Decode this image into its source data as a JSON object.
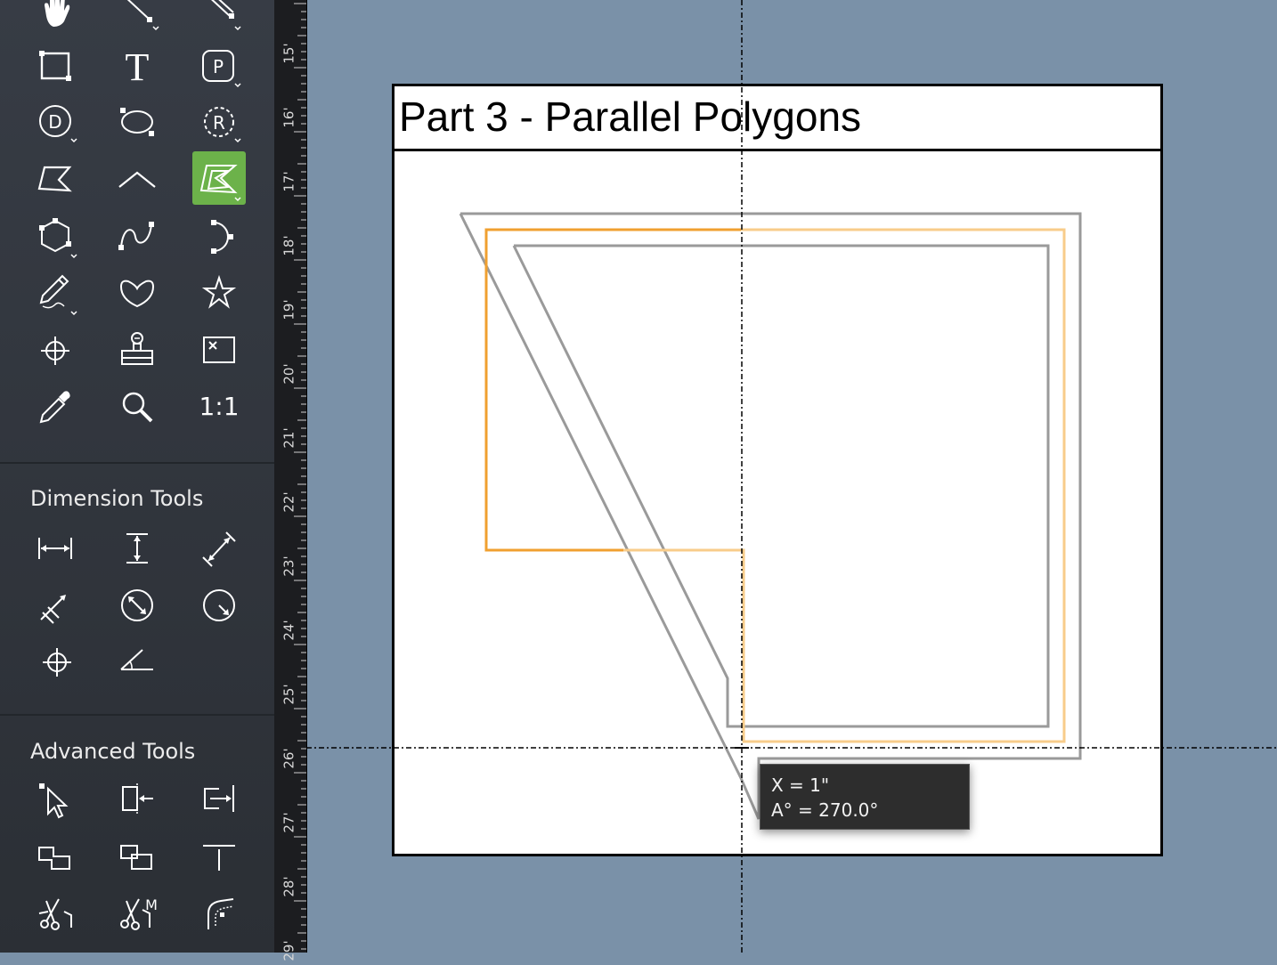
{
  "sidebar": {
    "dimension_tools_title": "Dimension Tools",
    "advanced_tools_title": "Advanced Tools",
    "actual_size_label": "1:1",
    "text_tool_glyph": "T",
    "point_tool_glyph": "P",
    "diameter_tool_glyph": "D",
    "radius_tool_glyph": "R",
    "active_tool_color": "#6cb24a",
    "move_tool_badge": "M"
  },
  "ruler": {
    "labels": [
      "15'",
      "16'",
      "17'",
      "18'",
      "19'",
      "20'",
      "21'",
      "22'",
      "23'",
      "24'",
      "25'",
      "26'",
      "27'",
      "28'",
      "29'"
    ]
  },
  "page": {
    "title": "Part 3 - Parallel Polygons"
  },
  "tooltip": {
    "x_readout": "X = 1\"",
    "angle_readout": "A° = 270.0°"
  },
  "colors": {
    "canvas_background": "#7a91a8",
    "selection_orange": "#f0a030",
    "parallel_gray": "#9a9a9a"
  }
}
